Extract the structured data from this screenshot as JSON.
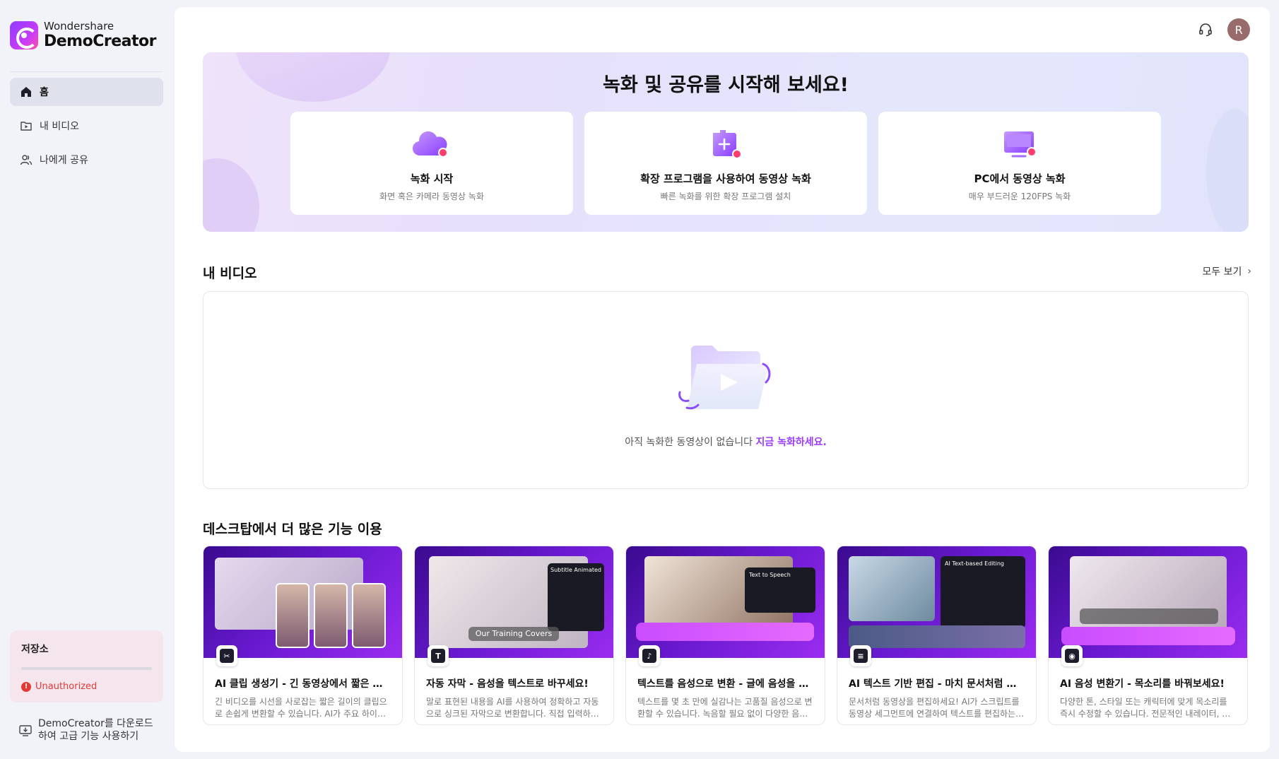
{
  "app": {
    "logo_sub": "Wondershare",
    "logo_main": "DemoCreator"
  },
  "sidebar": {
    "items": [
      {
        "label": "홈",
        "icon": "home-icon",
        "active": true
      },
      {
        "label": "내 비디오",
        "icon": "video-folder-icon",
        "active": false
      },
      {
        "label": "나에게 공유",
        "icon": "shared-users-icon",
        "active": false
      }
    ],
    "storage": {
      "title": "저장소",
      "status": "Unauthorized",
      "used_fraction": 0
    },
    "download_text": "DemoCreator를 다운로드하여 고급 기능 사용하기"
  },
  "header": {
    "avatar_initial": "R"
  },
  "hero": {
    "title": "녹화 및 공유를 시작해 보세요!",
    "cards": [
      {
        "title": "녹화 시작",
        "desc": "화면 혹은 카메라 동영상 녹화",
        "icon": "cloud-record-icon"
      },
      {
        "title": "확장 프로그램을 사용하여 동영상 녹화",
        "desc": "빠른 녹화를 위한 확장 프로그램 설치",
        "icon": "extension-record-icon"
      },
      {
        "title": "PC에서 동영상 녹화",
        "desc": "매우 부드러운 120FPS 녹화",
        "icon": "pc-record-icon"
      }
    ]
  },
  "my_videos": {
    "title": "내 비디오",
    "see_all": "모두 보기",
    "empty_text": "아직 녹화한 동영상이 없습니다",
    "empty_link": "지금 녹화하세요."
  },
  "features": {
    "title": "데스크탑에서 더 많은 기능 이용",
    "cards": [
      {
        "title": "AI 클립 생성기 - 긴 동영상에서 짧은 클립을 만들어보세요!",
        "desc": "긴 비디오를 시선을 사로잡는 짧은 길이의 클립으로 손쉽게 변환할 수 있습니다. AI가 주요 하이라이트를 찾아줍니다.",
        "thumb_texts": [],
        "icon": "ai-clip-icon"
      },
      {
        "title": "자동 자막 - 음성을 텍스트로 바꾸세요!",
        "desc": "말로 표현된 내용을 AI를 사용하여 정확하고 자동으로 싱크된 자막으로 변환합니다. 직접 입력하지 않아도 됩니다.",
        "thumb_texts": [
          "Subtitle Animated",
          "Our Training Covers"
        ],
        "icon": "subtitle-icon"
      },
      {
        "title": "텍스트를 음성으로 변환 - 글에 음성을 입혀보세요!",
        "desc": "텍스트를 몇 초 만에 실감나는 고품질 음성으로 변환할 수 있습니다. 녹음할 필요 없이 다양한 음성을 사용해 보세요.",
        "thumb_texts": [
          "Text to Speech"
        ],
        "icon": "tts-icon"
      },
      {
        "title": "AI 텍스트 기반 편집 - 마치 문서처럼 동영상을 편집하세요!",
        "desc": "문서처럼 동영상을 편집하세요! AI가 스크립트를 동영상 세그먼트에 연결하여 텍스트를 편집하는 것만으로 동영상을 편집할 수 있습니다.",
        "thumb_texts": [
          "AI Text-based Editing"
        ],
        "icon": "text-edit-icon"
      },
      {
        "title": "AI 음성 변환기 - 목소리를 바꿔보세요!",
        "desc": "다양한 톤, 스타일 또는 캐릭터에 맞게 목소리를 즉시 수정할 수 있습니다. 전문적인 내레이터, 재미있는 캐릭터 등으로 변신하세요.",
        "thumb_texts": [],
        "icon": "voice-changer-icon"
      }
    ]
  },
  "colors": {
    "accent": "#9b3bff",
    "error": "#e53935",
    "record_dot": "#ff3d6e"
  }
}
